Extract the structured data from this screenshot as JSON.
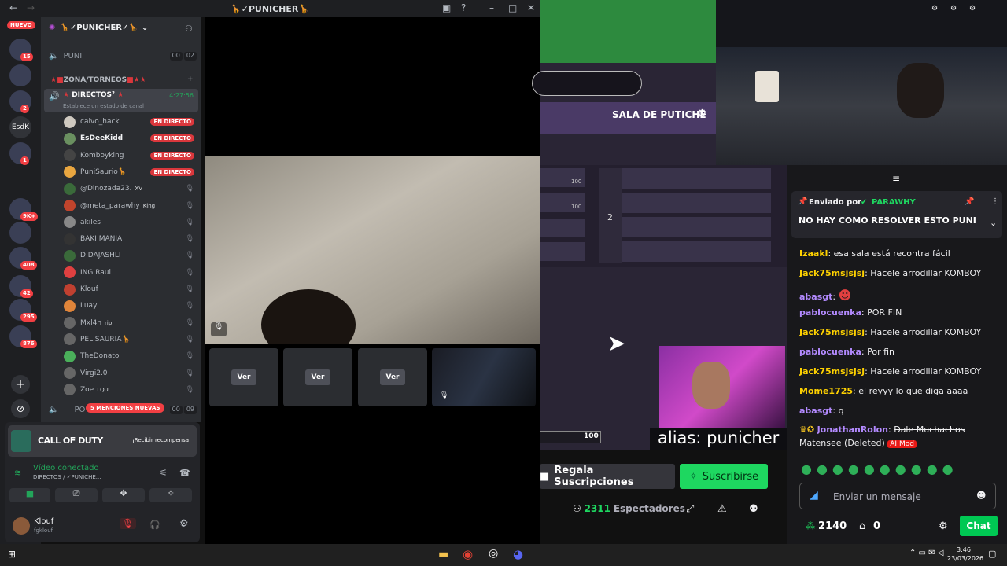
{
  "window": {
    "title": "🦒✓PUNICHER🦒"
  },
  "rail": {
    "new_label": "NUEVO",
    "servers": [
      {
        "badge": "15"
      },
      {
        "badge": ""
      },
      {
        "badge": "2"
      },
      {
        "label": "EsdK"
      },
      {
        "badge": "1"
      },
      {
        "badge": "9K+"
      },
      {
        "badge": ""
      },
      {
        "badge": "408"
      },
      {
        "badge": "42"
      },
      {
        "badge": "295"
      },
      {
        "badge": "876"
      }
    ]
  },
  "server": {
    "name": "🦒✓PUNICHER✓🦒",
    "channel_puni": "PUNI",
    "puni_counts": [
      "00",
      "02"
    ],
    "category": "ZONA/TORNEOS",
    "live_channel": "DIRECTOS",
    "live_time": "4:27:56",
    "status_hint": "Establece un estado de canal",
    "mentions": "5 MENCIONES NUEVAS",
    "po_channel": "PO",
    "po_counts": [
      "00",
      "09"
    ]
  },
  "live_label": "EN DIRECTO",
  "members": [
    {
      "name": "calvo_hack",
      "live": true
    },
    {
      "name": "EsDeeKidd",
      "live": true
    },
    {
      "name": "Komboyking",
      "live": true
    },
    {
      "name": "PuniSaurio🦒",
      "live": true
    },
    {
      "name": "@Dinozada23.",
      "tag": "XV"
    },
    {
      "name": "@meta_parawhy",
      "tag": "King"
    },
    {
      "name": "akiles"
    },
    {
      "name": "BAKI MANIA"
    },
    {
      "name": "D DAJASHLI"
    },
    {
      "name": "ING Raul"
    },
    {
      "name": "Klouf"
    },
    {
      "name": "Luay"
    },
    {
      "name": "Mxl4n",
      "tag": "rip"
    },
    {
      "name": "PELISAURIA🦒"
    },
    {
      "name": "TheDonato"
    },
    {
      "name": "Virgi2.0"
    },
    {
      "name": "Zoe",
      "tag": "LQU"
    }
  ],
  "promo": {
    "brand": "CALL OF DUTY",
    "cta": "¡Recibir recompensa!"
  },
  "voice": {
    "status": "Vídeo conectado",
    "path": "DIRECTOS / ✓PUNICHE..."
  },
  "user": {
    "name": "Klouf",
    "tag": "fgklouf"
  },
  "video": {
    "tile_label": "Ver"
  },
  "stream": {
    "room": "SALA DE PUTICHE",
    "slot_a": "100",
    "slot_b": "100",
    "row_num": "2",
    "health": "100",
    "alias": "alias: punicher"
  },
  "twitch": {
    "pinned_by": "Enviado por",
    "pinned_user": "PARAWHY",
    "pinned_text": "NO HAY COMO RESOLVER ESTO PUNI",
    "messages": [
      {
        "user": "Izaakl",
        "text": "esa sala está recontra fácil",
        "color": "#ffd200"
      },
      {
        "user": "Jack75msjsjsj",
        "text": "Hacele arrodillar KOMBOY",
        "color": "#ffd200"
      },
      {
        "user": "abasgt",
        "text": "",
        "color": "#b38aff"
      },
      {
        "user": "pablocuenka",
        "text": "POR FIN",
        "color": "#b38aff"
      },
      {
        "user": "Jack75msjsjsj",
        "text": "Hacele arrodillar KOMBOY",
        "color": "#ffd200"
      },
      {
        "user": "pablocuenka",
        "text": "Por fin",
        "color": "#b38aff"
      },
      {
        "user": "Jack75msjsjsj",
        "text": "Hacele arrodillar KOMBOY",
        "color": "#ffd200"
      },
      {
        "user": "Mome1725",
        "text": "el reyyy lo que diga aaaa",
        "color": "#ffd200"
      },
      {
        "user": "abasgt",
        "text": "q",
        "color": "#b38aff"
      }
    ],
    "last_user": "JonathanRolon",
    "last_text": "Dale Muchachos",
    "last_cont": "Matensee (Deleted)",
    "mod_badge": "AI Mod",
    "input_placeholder": "Enviar un mensaje",
    "points": "2140",
    "zero": "0",
    "chat_btn": "Chat"
  },
  "stream_footer": {
    "gift": "Regala Suscripciones",
    "subscribe": "Suscribirse",
    "viewers": "2311",
    "viewers_label": "Espectadores"
  },
  "clock": {
    "time": "3:46",
    "date": "23/03/2026"
  }
}
